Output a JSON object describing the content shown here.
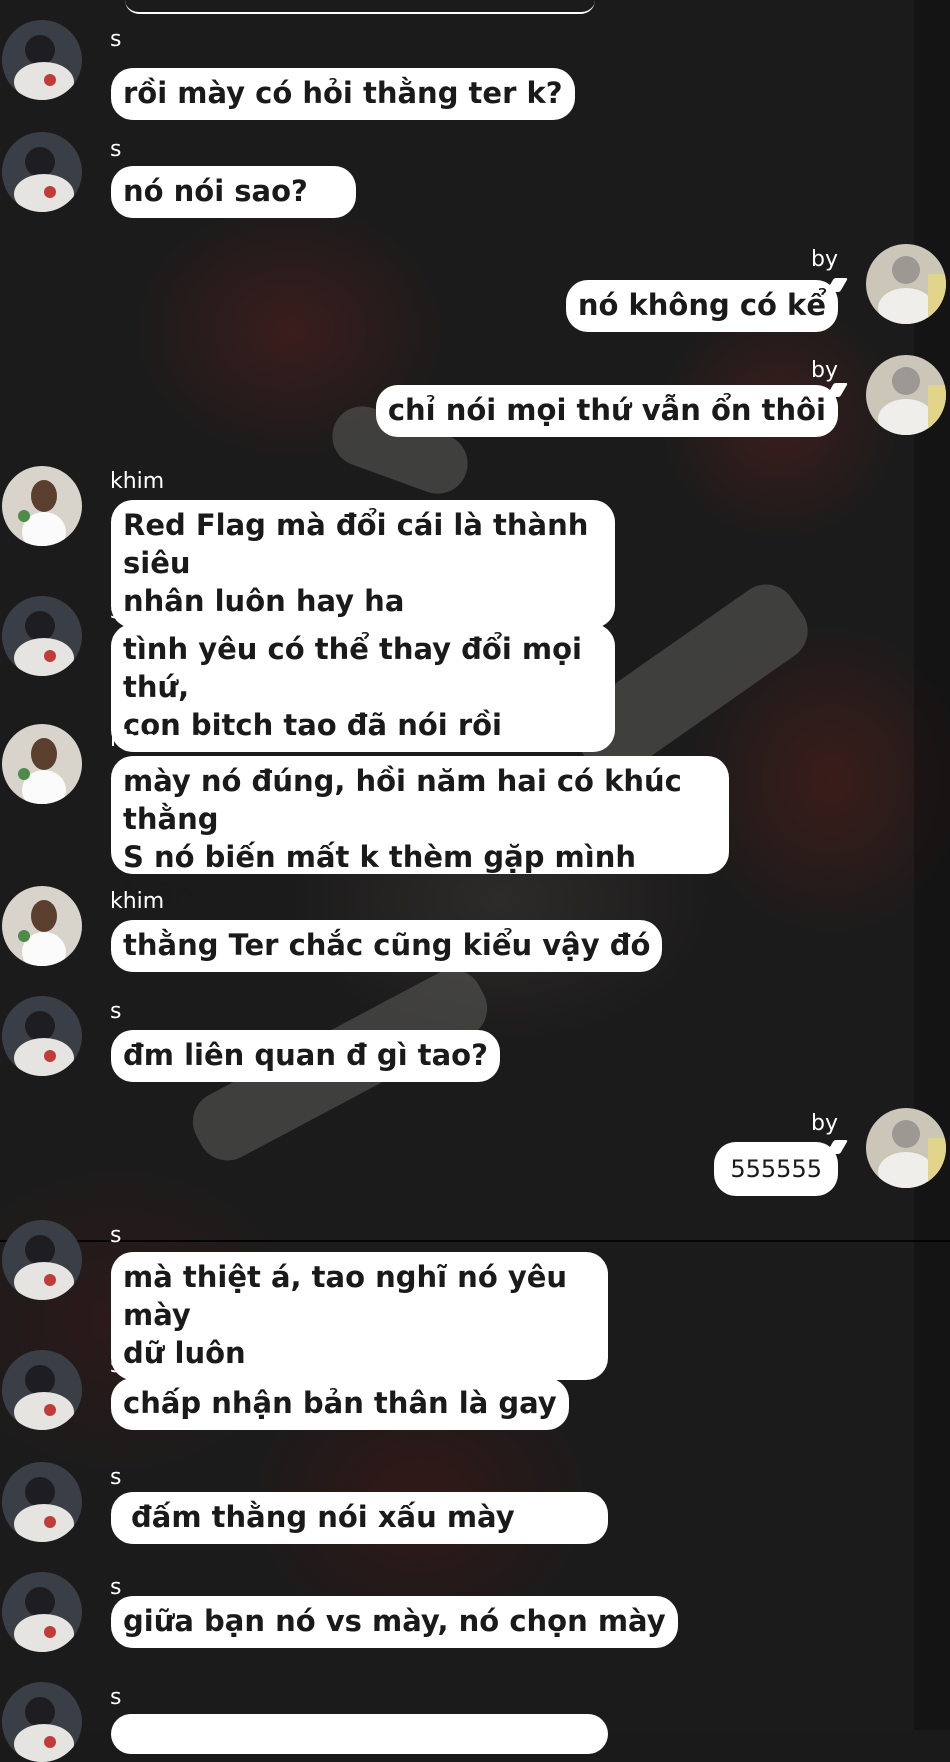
{
  "messages": [
    {
      "name": "s",
      "text": "rồi mày có hỏi thằng ter k?"
    },
    {
      "name": "s",
      "text": "nó nói sao?"
    },
    {
      "name": "by",
      "text": "nó không có kể"
    },
    {
      "name": "by",
      "text": "chỉ nói mọi thứ vẫn ổn thôi"
    },
    {
      "name": "khim",
      "line1": "Red Flag mà đổi cái là thành siêu",
      "line2": "nhân luôn hay ha"
    },
    {
      "name": "s",
      "line1": "tình yêu có thể thay đổi mọi thứ,",
      "line2": "con bitch tao đã nói rồi"
    },
    {
      "name": "khim",
      "line1": "mày nó đúng, hồi năm hai có khúc thằng",
      "line2": "S nó biến mất k thèm gặp mình luôn"
    },
    {
      "name": "khim",
      "text": "thằng Ter chắc cũng kiểu vậy đó"
    },
    {
      "name": "s",
      "text": "đm liên quan đ gì tao?"
    },
    {
      "name": "by",
      "text": "555555"
    },
    {
      "name": "s",
      "line1": "mà thiệt á, tao nghĩ nó yêu mày",
      "line2": "dữ luôn"
    },
    {
      "name": "s",
      "text": "chấp nhận bản thân là gay"
    },
    {
      "name": "s",
      "text": "đấm thằng nói xấu mày"
    },
    {
      "name": "s",
      "text": "giữa bạn nó vs mày, nó chọn mày"
    },
    {
      "name": "s",
      "text": ""
    }
  ],
  "colors": {
    "bubble": "#ffffff",
    "bubble_text": "#1a1a1a",
    "name_text": "#ffffff",
    "background": "#1c1b1b"
  }
}
